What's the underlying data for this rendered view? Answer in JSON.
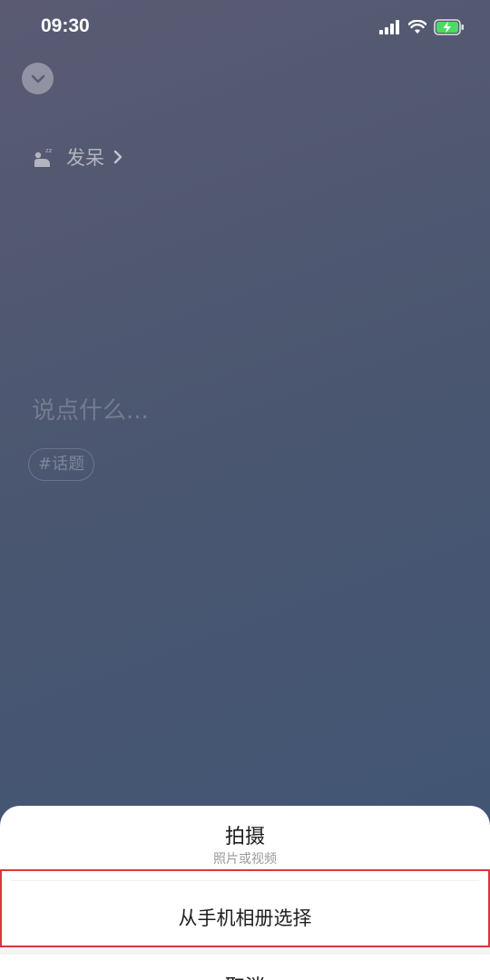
{
  "status_bar": {
    "time": "09:30",
    "icons": [
      "signal-icon",
      "wifi-icon",
      "battery-charging-icon"
    ],
    "battery_color": "#4cd964"
  },
  "header": {
    "collapse_icon": "chevron-down-icon"
  },
  "mood": {
    "icon": "sleeping-person-icon",
    "label": "发呆",
    "chevron_icon": "chevron-right-icon"
  },
  "compose": {
    "placeholder": "说点什么..."
  },
  "topic": {
    "label": "#话题"
  },
  "action_sheet": {
    "shoot_title": "拍摄",
    "shoot_subtitle": "照片或视频",
    "album_label": "从手机相册选择",
    "cancel_label": "取消",
    "highlight_color": "#d9363e"
  }
}
